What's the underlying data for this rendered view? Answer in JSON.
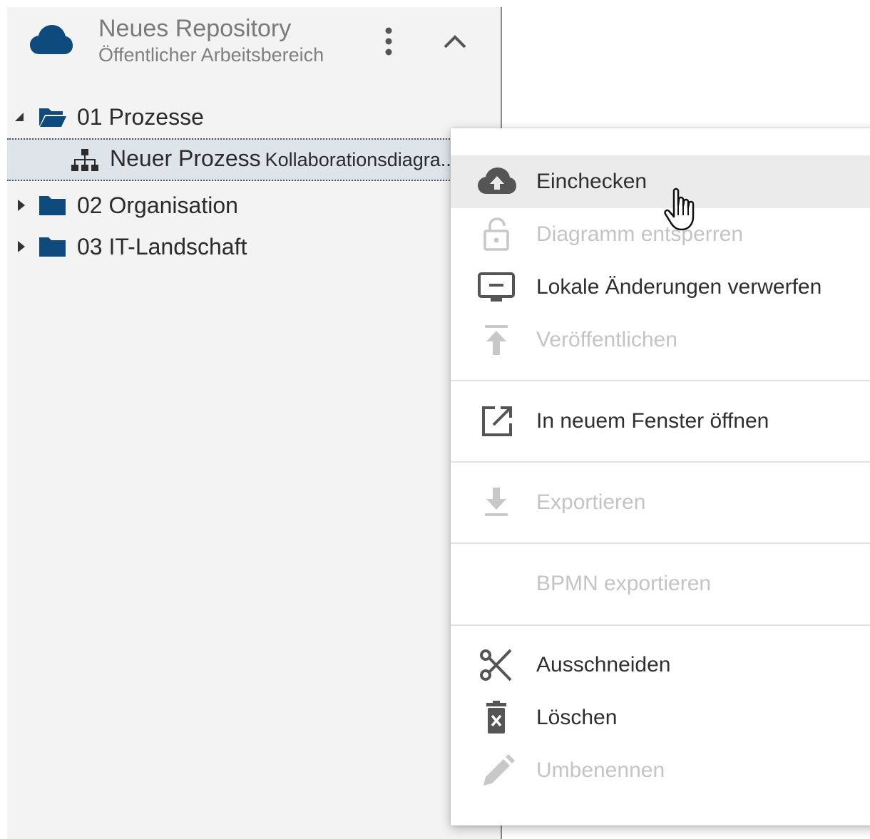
{
  "repository": {
    "title": "Neues Repository",
    "subtitle": "Öffentlicher Arbeitsbereich",
    "icon": "cloud-icon",
    "accent_color": "#0e4a7c"
  },
  "tree": [
    {
      "label": "01 Prozesse",
      "expanded": true
    },
    {
      "label": "Neuer Prozess",
      "suffix": "Kollaborationsdiagra...",
      "selected": true
    },
    {
      "label": "02 Organisation",
      "expanded": false
    },
    {
      "label": "03 IT-Landschaft",
      "expanded": false
    }
  ],
  "context_menu": {
    "items": [
      {
        "label": "Einchecken",
        "icon": "cloud-upload-icon",
        "enabled": true,
        "hovered": true
      },
      {
        "label": "Diagramm entsperren",
        "icon": "lock-open-icon",
        "enabled": false
      },
      {
        "label": "Lokale Änderungen verwerfen",
        "icon": "monitor-minus-icon",
        "enabled": true
      },
      {
        "label": "Veröffentlichen",
        "icon": "publish-icon",
        "enabled": false
      },
      {
        "label": "In neuem Fenster öffnen",
        "icon": "open-in-new-icon",
        "enabled": true
      },
      {
        "label": "Exportieren",
        "icon": "download-icon",
        "enabled": false
      },
      {
        "label": "BPMN exportieren",
        "icon": "",
        "enabled": false
      },
      {
        "label": "Ausschneiden",
        "icon": "scissors-icon",
        "enabled": true
      },
      {
        "label": "Löschen",
        "icon": "trash-icon",
        "enabled": true
      },
      {
        "label": "Umbenennen",
        "icon": "pencil-icon",
        "enabled": false
      }
    ]
  }
}
